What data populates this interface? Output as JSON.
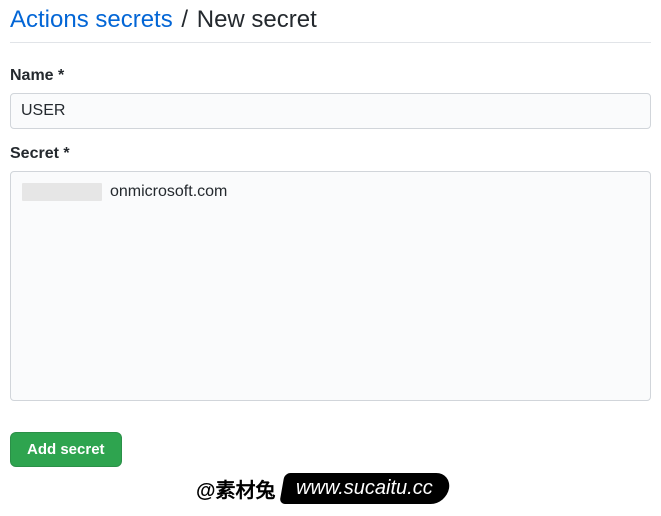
{
  "breadcrumb": {
    "parent": "Actions secrets",
    "separator": "/",
    "current": "New secret"
  },
  "form": {
    "name_label": "Name *",
    "name_value": "USER",
    "secret_label": "Secret *",
    "secret_value_visible": "onmicrosoft.com"
  },
  "actions": {
    "submit_label": "Add secret"
  },
  "watermark": {
    "left": "@素材兔",
    "right": "www.sucaitu.cc"
  }
}
